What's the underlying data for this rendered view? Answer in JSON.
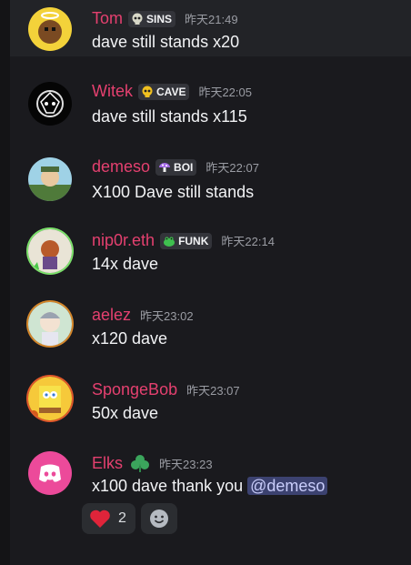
{
  "colors": {
    "username": "#e4406f",
    "timestamp": "#9a9ca3",
    "mention_bg": "#3c4270"
  },
  "messages": [
    {
      "username": "Tom",
      "tag": {
        "icon": "skull-icon",
        "label": "SINS"
      },
      "timestamp": "昨天21:49",
      "content": "dave still stands x20"
    },
    {
      "username": "Witek",
      "tag": {
        "icon": "skull-icon",
        "label": "CAVE"
      },
      "timestamp": "昨天22:05",
      "content": "dave still stands x115"
    },
    {
      "username": "demeso",
      "tag": {
        "icon": "mushroom-icon",
        "label": "BOI"
      },
      "timestamp": "昨天22:07",
      "content": "X100 Dave still stands"
    },
    {
      "username": "nip0r.eth",
      "tag": {
        "icon": "frog-icon",
        "label": "FUNK"
      },
      "timestamp": "昨天22:14",
      "content": "14x dave"
    },
    {
      "username": "aelez",
      "timestamp": "昨天23:02",
      "content": "x120 dave"
    },
    {
      "username": "SpongeBob",
      "timestamp": "昨天23:07",
      "content": "50x dave"
    },
    {
      "username": "Elks",
      "badge_icon": "clover-icon",
      "timestamp": "昨天23:23",
      "content": "x100 dave thank you ",
      "mention": "@demeso"
    }
  ],
  "reactions": [
    {
      "emoji": "heart-icon",
      "count": "2"
    },
    {
      "emoji": "add-reaction-icon"
    }
  ]
}
